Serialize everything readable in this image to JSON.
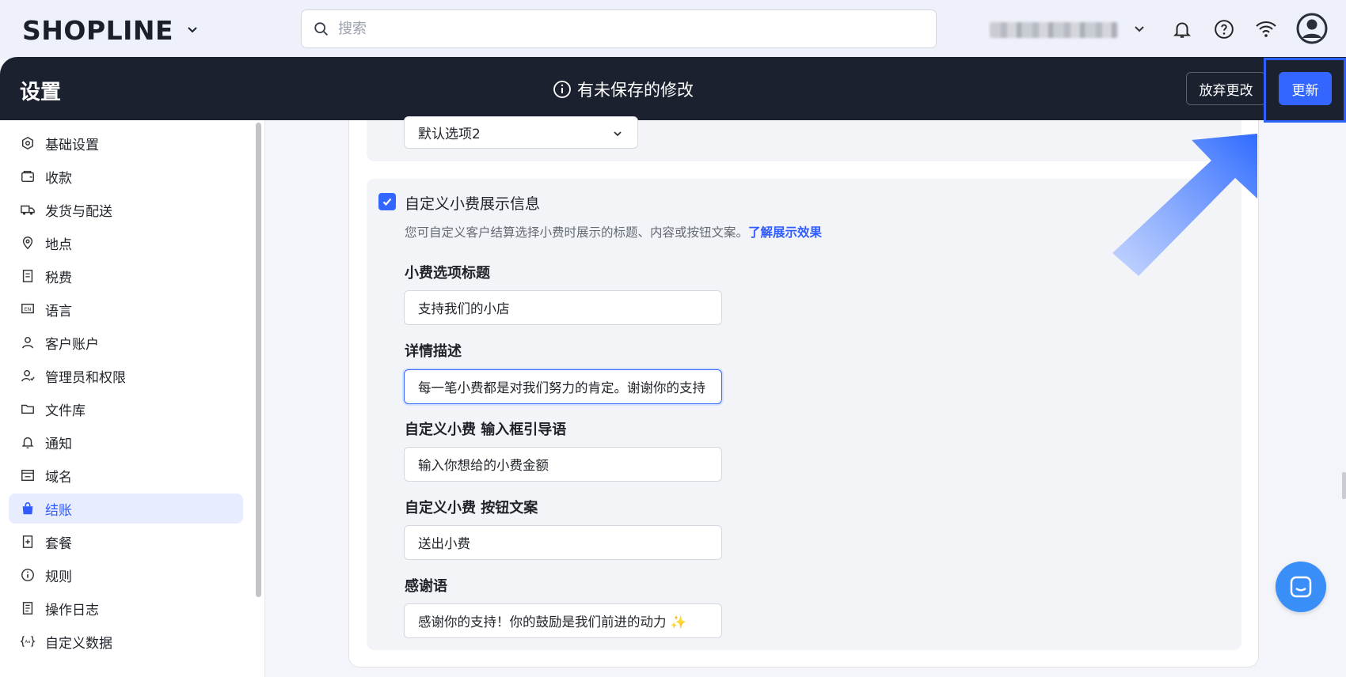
{
  "topbar": {
    "logo": "SHOPLINE",
    "search_placeholder": "搜索"
  },
  "header": {
    "title": "设置",
    "unsaved_message": "有未保存的修改",
    "discard_label": "放弃更改",
    "update_label": "更新"
  },
  "sidebar": {
    "items": [
      {
        "label": "基础设置",
        "icon": "gear-hex-icon"
      },
      {
        "label": "收款",
        "icon": "wallet-icon"
      },
      {
        "label": "发货与配送",
        "icon": "truck-icon"
      },
      {
        "label": "地点",
        "icon": "location-pin-icon"
      },
      {
        "label": "税费",
        "icon": "receipt-icon"
      },
      {
        "label": "语言",
        "icon": "language-en-icon"
      },
      {
        "label": "客户账户",
        "icon": "user-icon"
      },
      {
        "label": "管理员和权限",
        "icon": "admin-user-icon"
      },
      {
        "label": "文件库",
        "icon": "folder-icon"
      },
      {
        "label": "通知",
        "icon": "bell-icon"
      },
      {
        "label": "域名",
        "icon": "domain-icon"
      },
      {
        "label": "结账",
        "icon": "shopping-bag-icon",
        "active": true
      },
      {
        "label": "套餐",
        "icon": "plan-icon"
      },
      {
        "label": "规则",
        "icon": "info-circle-icon"
      },
      {
        "label": "操作日志",
        "icon": "log-icon"
      },
      {
        "label": "自定义数据",
        "icon": "custom-data-icon"
      }
    ]
  },
  "main": {
    "default_select_value": "默认选项2",
    "custom_tip_checkbox_label": "自定义小费展示信息",
    "custom_tip_checked": true,
    "hint_text": "您可自定义客户结算选择小费时展示的标题、内容或按钮文案。",
    "hint_link": "了解展示效果",
    "fields": [
      {
        "label": "小费选项标题",
        "value": "支持我们的小店"
      },
      {
        "label": "详情描述",
        "value": "每一笔小费都是对我们努力的肯定。谢谢你的支持",
        "focused": true
      },
      {
        "label": "自定义小费 输入框引导语",
        "value": "输入你想给的小费金额"
      },
      {
        "label": "自定义小费 按钮文案",
        "value": "送出小费"
      },
      {
        "label": "感谢语",
        "value": "感谢你的支持！你的鼓励是我们前进的动力 ✨"
      }
    ]
  },
  "colors": {
    "accent": "#3366ff",
    "header_bg": "#1c2130",
    "active_bg": "#e7edff",
    "chat": "#3a8ef7"
  }
}
